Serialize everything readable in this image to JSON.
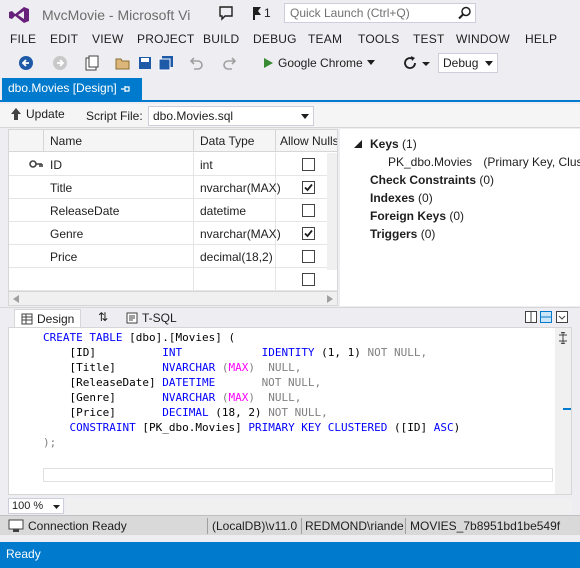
{
  "window": {
    "title": "MvcMovie - Microsoft Vi",
    "notification_count": "1"
  },
  "quick_launch": {
    "placeholder": "Quick Launch (Ctrl+Q)"
  },
  "menu": [
    "FILE",
    "EDIT",
    "VIEW",
    "PROJECT",
    "BUILD",
    "DEBUG",
    "TEAM",
    "TOOLS",
    "TEST",
    "WINDOW",
    "HELP"
  ],
  "toolbar": {
    "browser_label": "Google Chrome",
    "configuration": "Debug"
  },
  "document_tab": {
    "label": "dbo.Movies [Design]"
  },
  "designer": {
    "update_label": "Update",
    "script_file_label": "Script File:",
    "script_file": "dbo.Movies.sql"
  },
  "grid": {
    "headers": [
      "Name",
      "Data Type",
      "Allow Nulls"
    ],
    "rows": [
      {
        "name": "ID",
        "type": "int",
        "allow_nulls": false,
        "key": true
      },
      {
        "name": "Title",
        "type": "nvarchar(MAX)",
        "allow_nulls": true,
        "key": false
      },
      {
        "name": "ReleaseDate",
        "type": "datetime",
        "allow_nulls": false,
        "key": false
      },
      {
        "name": "Genre",
        "type": "nvarchar(MAX)",
        "allow_nulls": true,
        "key": false
      },
      {
        "name": "Price",
        "type": "decimal(18,2)",
        "allow_nulls": false,
        "key": false
      },
      {
        "name": "",
        "type": "",
        "allow_nulls": false,
        "key": false
      }
    ]
  },
  "properties": {
    "keys_label": "Keys",
    "keys_count": "(1)",
    "key_name": "PK_dbo.Movies",
    "key_detail": "(Primary Key, Clus",
    "check_label": "Check Constraints",
    "check_count": "(0)",
    "indexes_label": "Indexes",
    "indexes_count": "(0)",
    "foreign_label": "Foreign Keys",
    "foreign_count": "(0)",
    "triggers_label": "Triggers",
    "triggers_count": "(0)"
  },
  "pane_tabs": {
    "design": "Design",
    "swap": "⇅",
    "tsql": "T-SQL"
  },
  "sql": {
    "l1a": "CREATE TABLE",
    "l1b": " [dbo].[Movies] (",
    "l2a": "    [ID]          ",
    "l2b": "INT",
    "l2c": "            ",
    "l2d": "IDENTITY",
    "l2e": " (1, 1) ",
    "l2f": "NOT NULL,",
    "l3a": "    [Title]       ",
    "l3b": "NVARCHAR",
    "l3c": " (",
    "l3d": "MAX",
    "l3e": ")  ",
    "l3f": "NULL,",
    "l4a": "    [ReleaseDate] ",
    "l4b": "DATETIME",
    "l4c": "       ",
    "l4d": "NOT NULL,",
    "l5a": "    [Genre]       ",
    "l5b": "NVARCHAR",
    "l5c": " (",
    "l5d": "MAX",
    "l5e": ")  ",
    "l5f": "NULL,",
    "l6a": "    [Price]       ",
    "l6b": "DECIMAL",
    "l6c": " (18, 2) ",
    "l6d": "NOT NULL,",
    "l7a": "    ",
    "l7b": "CONSTRAINT",
    "l7c": " [PK_dbo.Movies] ",
    "l7d": "PRIMARY KEY CLUSTERED",
    "l7e": " ([ID] ",
    "l7f": "ASC",
    "l7g": ")",
    "l8": ");"
  },
  "zoom": "100 %",
  "connection": {
    "status": "Connection Ready",
    "server": "(LocalDB)\\v11.0",
    "user": "REDMOND\\riande",
    "database": "MOVIES_7b8951bd1be549f"
  },
  "status": {
    "text": "Ready"
  },
  "colors": {
    "accent": "#007acc",
    "keyword": "#0000ff",
    "function": "#ff00ff",
    "gray": "#808080"
  }
}
